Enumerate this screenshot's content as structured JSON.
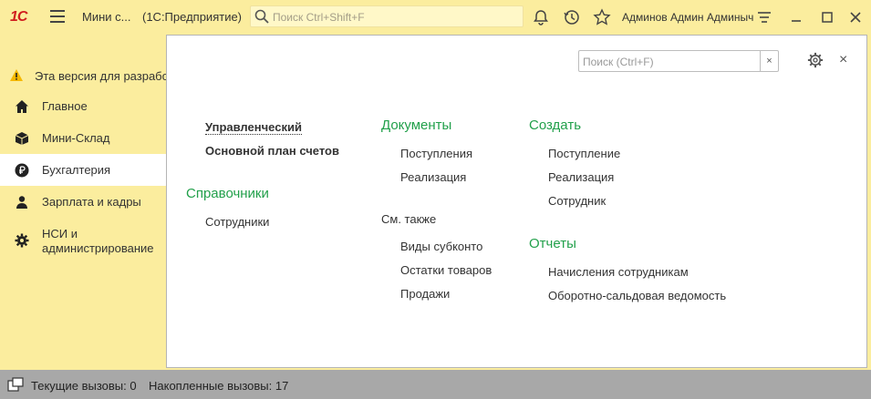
{
  "titlebar": {
    "logo_text": "1С",
    "app_title": "Мини с...",
    "app_subtitle": "(1С:Предприятие)",
    "search_placeholder": "Поиск Ctrl+Shift+F",
    "user_name": "Админов Админ Админыч",
    "icons": [
      "bell-icon",
      "history-icon",
      "star-icon",
      "settings-lines-icon",
      "minimize-icon",
      "maximize-icon",
      "close-icon"
    ]
  },
  "info": {
    "text": "Эта версия для разрабо"
  },
  "sidebar": {
    "items": [
      {
        "label": "Главное",
        "icon": "home-icon"
      },
      {
        "label": "Мини-Склад",
        "icon": "box-icon"
      },
      {
        "label": "Бухгалтерия",
        "icon": "ruble-icon",
        "active": true
      },
      {
        "label": "Зарплата и кадры",
        "icon": "person-icon"
      },
      {
        "label": "НСИ и администрирование",
        "icon": "gear-icon"
      }
    ]
  },
  "panel": {
    "search_placeholder": "Поиск (Ctrl+F)",
    "clear_label": "×",
    "close_label": "×",
    "col1": {
      "top_links": [
        "Управленческий",
        "Основной план счетов"
      ],
      "section": "Справочники",
      "section_links": [
        "Сотрудники"
      ]
    },
    "col2": {
      "section": "Документы",
      "section_links": [
        "Поступления",
        "Реализация"
      ],
      "see_also": "См. также",
      "see_also_links": [
        "Виды субконто",
        "Остатки товаров",
        "Продажи"
      ]
    },
    "col3": {
      "section1": "Создать",
      "section1_links": [
        "Поступление",
        "Реализация",
        "Сотрудник"
      ],
      "section2": "Отчеты",
      "section2_links": [
        "Начисления сотрудникам",
        "Оборотно-сальдовая ведомость"
      ]
    }
  },
  "status": {
    "current_calls": "Текущие вызовы: 0",
    "accumulated_calls": "Накопленные вызовы: 17"
  },
  "colors": {
    "accent_bg": "#fbed9e",
    "section_green": "#22a04b",
    "logo_red": "#d01e1e",
    "status_gray": "#a8a8a8"
  }
}
